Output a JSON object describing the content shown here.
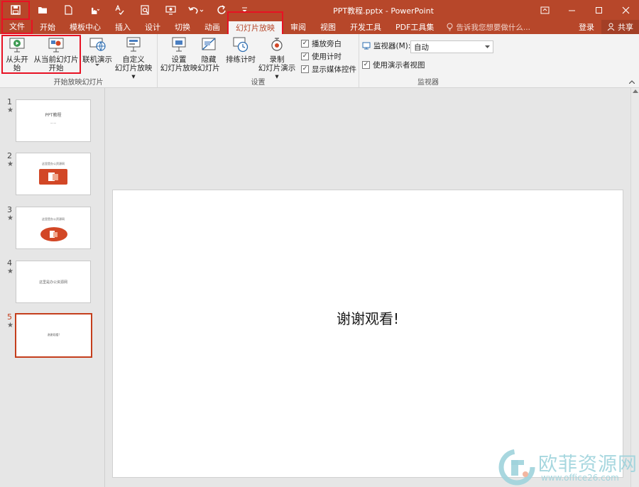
{
  "titlebar": {
    "doc_title": "PPT教程.pptx - PowerPoint",
    "qat": [
      "save-icon",
      "open-icon",
      "new-icon",
      "touch-mode-icon",
      "spellcheck-icon",
      "print-preview-icon",
      "from-beginning-icon",
      "undo-icon",
      "redo-icon",
      "customize-qat-icon"
    ],
    "window_controls": [
      "ribbon-display-icon",
      "minimize-icon",
      "maximize-icon",
      "close-icon"
    ]
  },
  "tabs": {
    "items": [
      "文件",
      "开始",
      "模板中心",
      "插入",
      "设计",
      "切换",
      "动画",
      "幻灯片放映",
      "审阅",
      "视图",
      "开发工具",
      "PDF工具集"
    ],
    "active": "幻灯片放映",
    "tell_me": "告诉我您想要做什么...",
    "login": "登录",
    "share": "共享"
  },
  "ribbon": {
    "group_start": {
      "label": "开始放映幻灯片",
      "from_beginning": "从头开始",
      "from_current_line1": "从当前幻灯片",
      "from_current_line2": "开始",
      "online": "联机演示",
      "custom_line1": "自定义",
      "custom_line2": "幻灯片放映"
    },
    "group_setup": {
      "label": "设置",
      "setup_line1": "设置",
      "setup_line2": "幻灯片放映",
      "hide_line1": "隐藏",
      "hide_line2": "幻灯片",
      "rehearse": "排练计时",
      "record_line1": "录制",
      "record_line2": "幻灯片演示",
      "play_narrations": "播放旁白",
      "use_timings": "使用计时",
      "show_media_controls": "显示媒体控件"
    },
    "group_monitor": {
      "label": "监视器",
      "monitor_label": "监视器(M):",
      "monitor_value": "自动",
      "presenter_view": "使用演示者视图"
    }
  },
  "thumbnails": [
    {
      "num": "1",
      "star": "★",
      "title": "PPT教程",
      "sub": "·······"
    },
    {
      "num": "2",
      "star": "★",
      "title": "这里是办公资源网"
    },
    {
      "num": "3",
      "star": "★",
      "title": "这里是办公资源网"
    },
    {
      "num": "4",
      "star": "★",
      "title": "这里是办公资源网"
    },
    {
      "num": "5",
      "star": "★",
      "title": "谢谢观看!"
    }
  ],
  "slide": {
    "text": "谢谢观看!"
  },
  "watermark": {
    "text": "欧菲资源网",
    "url": "www.office26.com"
  },
  "colors": {
    "accent": "#b7472a",
    "highlight": "#e81123",
    "selected_thumb": "#c43e1c",
    "watermark": "#9ed3dc"
  }
}
